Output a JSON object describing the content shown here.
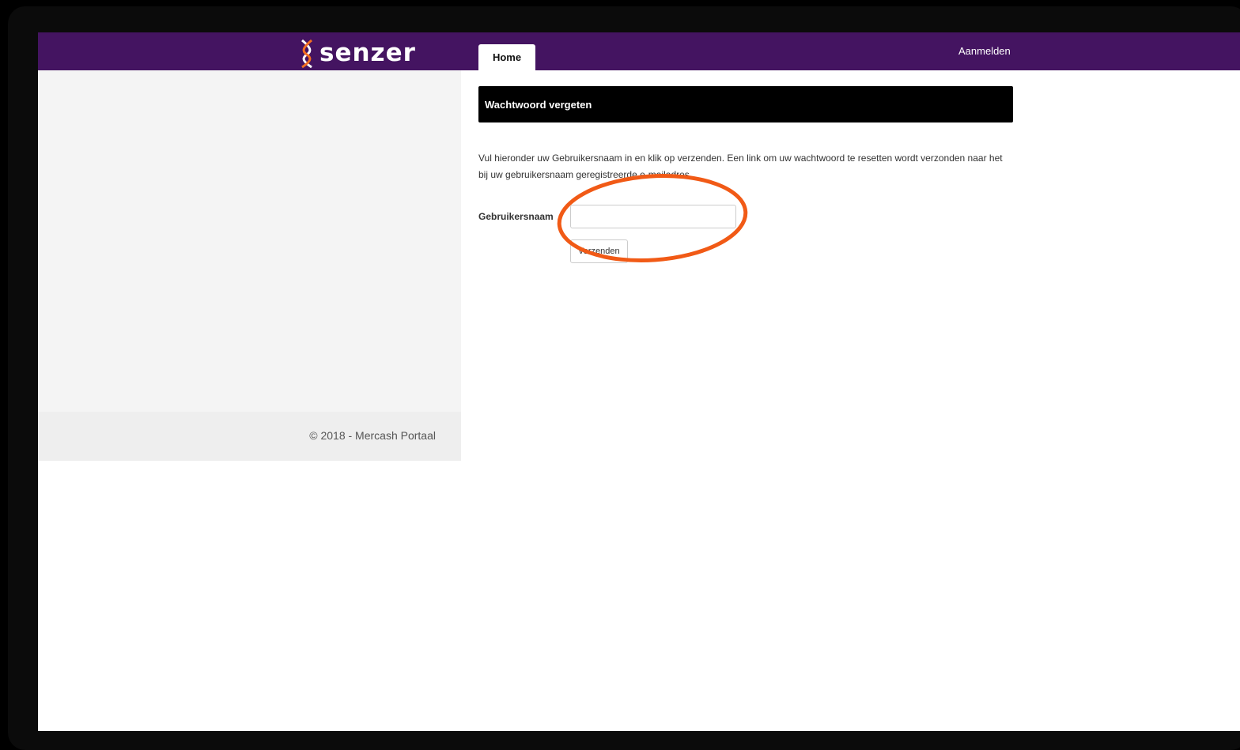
{
  "header": {
    "logo_text": "senzer",
    "tab_home": "Home",
    "login_link": "Aanmelden",
    "bar_color": "#441461",
    "logo_accent_color": "#f36f21"
  },
  "main": {
    "section_title": "Wachtwoord vergeten",
    "description": "Vul hieronder uw Gebruikersnaam in en klik op verzenden. Een link om uw wachtwoord te resetten wordt verzonden naar het bij uw gebruikersnaam geregistreerde e-mailadres.",
    "form": {
      "username_label": "Gebruikersnaam",
      "username_value": "",
      "submit_label": "Verzenden"
    }
  },
  "footer": {
    "copyright": "© 2018 - Mercash Portaal"
  },
  "annotation": {
    "shape": "ellipse",
    "color": "#f15a16"
  }
}
